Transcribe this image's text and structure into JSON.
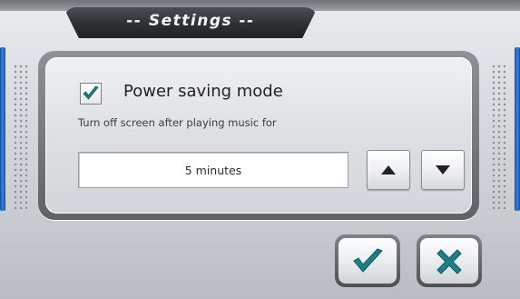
{
  "dialog": {
    "title": "-- Settings --"
  },
  "power_saving": {
    "checked": true,
    "label": "Power saving mode",
    "description": "Turn off screen after playing music for",
    "value": "5 minutes"
  },
  "icons": {
    "checkbox": "checkmark-icon",
    "increase": "up-arrow-icon",
    "decrease": "down-arrow-icon",
    "confirm": "checkmark-icon",
    "cancel": "x-icon"
  },
  "colors": {
    "accent_teal": "#1f7f86",
    "title_bar": "#2d3034",
    "edge_blue": "#1b64c8"
  }
}
